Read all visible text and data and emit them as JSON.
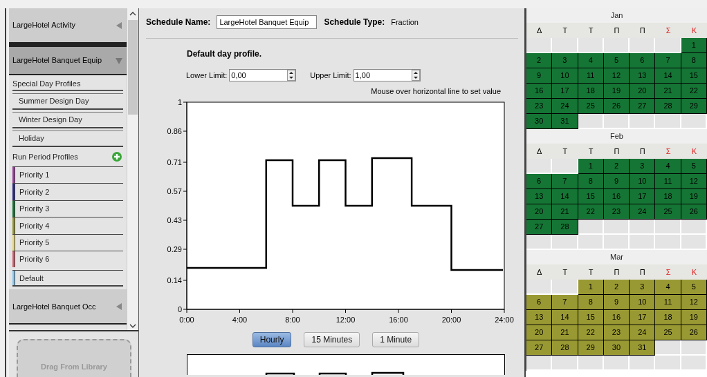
{
  "sidebar": {
    "schedules": [
      {
        "name": "LargeHotel Activity",
        "expanded": false
      },
      {
        "name": "LargeHotel Banquet Equip",
        "expanded": true,
        "special_day_heading": "Special Day Profiles",
        "special_days": [
          "Summer Design Day",
          "Winter Design Day",
          "Holiday"
        ],
        "run_period_heading": "Run Period Profiles",
        "priorities": [
          {
            "label": "Priority 1",
            "color": "#9c3c9c"
          },
          {
            "label": "Priority 2",
            "color": "#2a2a86"
          },
          {
            "label": "Priority 3",
            "color": "#157535"
          },
          {
            "label": "Priority 4",
            "color": "#959531"
          },
          {
            "label": "Priority 5",
            "color": "#e8d87a"
          },
          {
            "label": "Priority 6",
            "color": "#d06070"
          }
        ],
        "default_profile": {
          "label": "Default",
          "color": "#86c8ee"
        }
      },
      {
        "name": "LargeHotel Banquet Occ",
        "expanded": false
      }
    ],
    "library_drop": "Drag From Library"
  },
  "schedule": {
    "name_label": "Schedule Name:",
    "name_value": "LargeHotel Banquet Equip",
    "type_label": "Schedule Type:",
    "type_value": "Fraction",
    "profile_title": "Default day profile.",
    "lower_label": "Lower Limit:",
    "lower_value": "0,00",
    "upper_label": "Upper Limit:",
    "upper_value": "1,00",
    "hint": "Mouse over horizontal line to set value",
    "chart_data": {
      "type": "line",
      "x": [
        0,
        6,
        6,
        8,
        8,
        10,
        10,
        12,
        12,
        14,
        14,
        17,
        17,
        20,
        20,
        23.9
      ],
      "series": [
        {
          "color": "#000000",
          "values": [
            0.2,
            0.2,
            0.72,
            0.72,
            0.5,
            0.5,
            0.72,
            0.72,
            0.5,
            0.5,
            0.73,
            0.73,
            0.5,
            0.5,
            0.19,
            0.19
          ]
        }
      ],
      "xlim": [
        0,
        24
      ],
      "ylim": [
        0,
        1
      ],
      "xticks": [
        {
          "value": 0,
          "label": "0:00"
        },
        {
          "value": 4,
          "label": "4:00"
        },
        {
          "value": 8,
          "label": "8:00"
        },
        {
          "value": 12,
          "label": "12:00"
        },
        {
          "value": 16,
          "label": "16:00"
        },
        {
          "value": 20,
          "label": "20:00"
        },
        {
          "value": 24,
          "label": "24:00"
        }
      ],
      "yticks": [
        {
          "value": 0,
          "label": "0"
        },
        {
          "value": 0.14,
          "label": "0.14"
        },
        {
          "value": 0.29,
          "label": "0.29"
        },
        {
          "value": 0.43,
          "label": "0.43"
        },
        {
          "value": 0.57,
          "label": "0.57"
        },
        {
          "value": 0.71,
          "label": "0.71"
        },
        {
          "value": 0.86,
          "label": "0.86"
        },
        {
          "value": 1,
          "label": "1"
        }
      ]
    },
    "resolution_buttons": [
      {
        "label": "Hourly",
        "selected": true
      },
      {
        "label": "15 Minutes",
        "selected": false
      },
      {
        "label": "1 Minute",
        "selected": false
      }
    ]
  },
  "calendar": {
    "months": [
      {
        "name": "Jan",
        "color": "#157535",
        "weekdays": [
          {
            "label": "Δ",
            "weekend": false
          },
          {
            "label": "Τ",
            "weekend": false
          },
          {
            "label": "Τ",
            "weekend": false
          },
          {
            "label": "Π",
            "weekend": false
          },
          {
            "label": "Π",
            "weekend": false
          },
          {
            "label": "Σ",
            "weekend": true
          },
          {
            "label": "Κ",
            "weekend": true
          }
        ],
        "weeks": [
          [
            {
              "kind": "empty"
            },
            {
              "kind": "empty"
            },
            {
              "kind": "empty"
            },
            {
              "kind": "empty"
            },
            {
              "kind": "empty"
            },
            {
              "kind": "empty"
            },
            {
              "kind": "day",
              "day": "1"
            }
          ],
          [
            {
              "kind": "day",
              "day": "2"
            },
            {
              "kind": "day",
              "day": "3"
            },
            {
              "kind": "day",
              "day": "4"
            },
            {
              "kind": "day",
              "day": "5"
            },
            {
              "kind": "day",
              "day": "6"
            },
            {
              "kind": "day",
              "day": "7"
            },
            {
              "kind": "day",
              "day": "8"
            }
          ],
          [
            {
              "kind": "day",
              "day": "9"
            },
            {
              "kind": "day",
              "day": "10"
            },
            {
              "kind": "day",
              "day": "11"
            },
            {
              "kind": "day",
              "day": "12"
            },
            {
              "kind": "day",
              "day": "13"
            },
            {
              "kind": "day",
              "day": "14"
            },
            {
              "kind": "day",
              "day": "15"
            }
          ],
          [
            {
              "kind": "day",
              "day": "16"
            },
            {
              "kind": "day",
              "day": "17"
            },
            {
              "kind": "day",
              "day": "18"
            },
            {
              "kind": "day",
              "day": "19"
            },
            {
              "kind": "day",
              "day": "20"
            },
            {
              "kind": "day",
              "day": "21"
            },
            {
              "kind": "day",
              "day": "22"
            }
          ],
          [
            {
              "kind": "day",
              "day": "23"
            },
            {
              "kind": "day",
              "day": "24"
            },
            {
              "kind": "day",
              "day": "25"
            },
            {
              "kind": "day",
              "day": "26"
            },
            {
              "kind": "day",
              "day": "27"
            },
            {
              "kind": "day",
              "day": "28"
            },
            {
              "kind": "day",
              "day": "29"
            }
          ],
          [
            {
              "kind": "day",
              "day": "30"
            },
            {
              "kind": "day",
              "day": "31"
            },
            {
              "kind": "empty"
            },
            {
              "kind": "empty"
            },
            {
              "kind": "empty"
            },
            {
              "kind": "empty"
            },
            {
              "kind": "empty"
            }
          ]
        ]
      },
      {
        "name": "Feb",
        "color": "#157535",
        "weekdays": [
          {
            "label": "Δ",
            "weekend": false
          },
          {
            "label": "Τ",
            "weekend": false
          },
          {
            "label": "Τ",
            "weekend": false
          },
          {
            "label": "Π",
            "weekend": false
          },
          {
            "label": "Π",
            "weekend": false
          },
          {
            "label": "Σ",
            "weekend": true
          },
          {
            "label": "Κ",
            "weekend": true
          }
        ],
        "weeks": [
          [
            {
              "kind": "empty"
            },
            {
              "kind": "empty"
            },
            {
              "kind": "day",
              "day": "1"
            },
            {
              "kind": "day",
              "day": "2"
            },
            {
              "kind": "day",
              "day": "3"
            },
            {
              "kind": "day",
              "day": "4"
            },
            {
              "kind": "day",
              "day": "5"
            }
          ],
          [
            {
              "kind": "day",
              "day": "6"
            },
            {
              "kind": "day",
              "day": "7"
            },
            {
              "kind": "day",
              "day": "8"
            },
            {
              "kind": "day",
              "day": "9"
            },
            {
              "kind": "day",
              "day": "10"
            },
            {
              "kind": "day",
              "day": "11"
            },
            {
              "kind": "day",
              "day": "12"
            }
          ],
          [
            {
              "kind": "day",
              "day": "13"
            },
            {
              "kind": "day",
              "day": "14"
            },
            {
              "kind": "day",
              "day": "15"
            },
            {
              "kind": "day",
              "day": "16"
            },
            {
              "kind": "day",
              "day": "17"
            },
            {
              "kind": "day",
              "day": "18"
            },
            {
              "kind": "day",
              "day": "19"
            }
          ],
          [
            {
              "kind": "day",
              "day": "20"
            },
            {
              "kind": "day",
              "day": "21"
            },
            {
              "kind": "day",
              "day": "22"
            },
            {
              "kind": "day",
              "day": "23"
            },
            {
              "kind": "day",
              "day": "24"
            },
            {
              "kind": "day",
              "day": "25"
            },
            {
              "kind": "day",
              "day": "26"
            }
          ],
          [
            {
              "kind": "day",
              "day": "27"
            },
            {
              "kind": "day",
              "day": "28"
            },
            {
              "kind": "empty"
            },
            {
              "kind": "empty"
            },
            {
              "kind": "empty"
            },
            {
              "kind": "empty"
            },
            {
              "kind": "empty"
            }
          ],
          [
            {
              "kind": "empty"
            },
            {
              "kind": "empty"
            },
            {
              "kind": "empty"
            },
            {
              "kind": "empty"
            },
            {
              "kind": "empty"
            },
            {
              "kind": "empty"
            },
            {
              "kind": "empty"
            }
          ]
        ]
      },
      {
        "name": "Mar",
        "color": "#999933",
        "weekdays": [
          {
            "label": "Δ",
            "weekend": false
          },
          {
            "label": "Τ",
            "weekend": false
          },
          {
            "label": "Τ",
            "weekend": false
          },
          {
            "label": "Π",
            "weekend": false
          },
          {
            "label": "Π",
            "weekend": false
          },
          {
            "label": "Σ",
            "weekend": true
          },
          {
            "label": "Κ",
            "weekend": true
          }
        ],
        "weeks": [
          [
            {
              "kind": "empty"
            },
            {
              "kind": "empty"
            },
            {
              "kind": "day",
              "day": "1"
            },
            {
              "kind": "day",
              "day": "2"
            },
            {
              "kind": "day",
              "day": "3"
            },
            {
              "kind": "day",
              "day": "4"
            },
            {
              "kind": "day",
              "day": "5"
            }
          ],
          [
            {
              "kind": "day",
              "day": "6"
            },
            {
              "kind": "day",
              "day": "7"
            },
            {
              "kind": "day",
              "day": "8"
            },
            {
              "kind": "day",
              "day": "9"
            },
            {
              "kind": "day",
              "day": "10"
            },
            {
              "kind": "day",
              "day": "11"
            },
            {
              "kind": "day",
              "day": "12"
            }
          ],
          [
            {
              "kind": "day",
              "day": "13"
            },
            {
              "kind": "day",
              "day": "14"
            },
            {
              "kind": "day",
              "day": "15"
            },
            {
              "kind": "day",
              "day": "16"
            },
            {
              "kind": "day",
              "day": "17"
            },
            {
              "kind": "day",
              "day": "18"
            },
            {
              "kind": "day",
              "day": "19"
            }
          ],
          [
            {
              "kind": "day",
              "day": "20"
            },
            {
              "kind": "day",
              "day": "21"
            },
            {
              "kind": "day",
              "day": "22"
            },
            {
              "kind": "day",
              "day": "23"
            },
            {
              "kind": "day",
              "day": "24"
            },
            {
              "kind": "day",
              "day": "25"
            },
            {
              "kind": "day",
              "day": "26"
            }
          ],
          [
            {
              "kind": "day",
              "day": "27"
            },
            {
              "kind": "day",
              "day": "28"
            },
            {
              "kind": "day",
              "day": "29"
            },
            {
              "kind": "day",
              "day": "30"
            },
            {
              "kind": "day",
              "day": "31"
            },
            {
              "kind": "empty"
            },
            {
              "kind": "empty"
            }
          ],
          [
            {
              "kind": "empty"
            },
            {
              "kind": "empty"
            },
            {
              "kind": "empty"
            },
            {
              "kind": "empty"
            },
            {
              "kind": "empty"
            },
            {
              "kind": "empty"
            },
            {
              "kind": "empty"
            }
          ]
        ]
      }
    ]
  }
}
